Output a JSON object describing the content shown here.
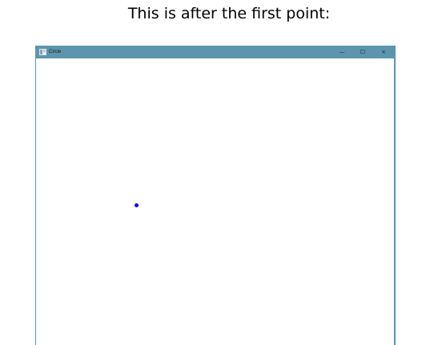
{
  "caption": "This is after the first point:",
  "window": {
    "title": "Circle",
    "title_bar_color": "#5c95ad",
    "controls": {
      "minimize": "—",
      "maximize": "☐",
      "close": "×"
    }
  },
  "canvas": {
    "point_color": "#0000ff"
  }
}
